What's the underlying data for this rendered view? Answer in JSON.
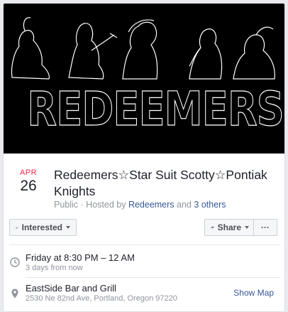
{
  "cover": {
    "band_name": "REDEEMERS"
  },
  "event": {
    "month": "APR",
    "day": "26",
    "title": "Redeemers☆Star Suit Scotty☆Pontiak Knights",
    "privacy": "Public",
    "hosted_by_prefix": "· Hosted by",
    "host": "Redeemers",
    "and_text": "and",
    "others": "3 others"
  },
  "actions": {
    "interested_label": "Interested",
    "share_label": "Share",
    "more_label": "···"
  },
  "details": {
    "time": "Friday at 8:30 PM – 12 AM",
    "time_relative": "3 days from now",
    "venue": "EastSide Bar and Grill",
    "address": "2530 Ne 82nd Ave, Portland, Oregon 97220",
    "show_map": "Show Map"
  },
  "colors": {
    "month_red": "#f02849",
    "link_blue": "#385898",
    "muted_gray": "#90949c"
  },
  "icons": {
    "checkmark": "checkmark-icon",
    "share": "share-arrow-icon",
    "clock": "clock-icon",
    "location": "map-pin-icon"
  }
}
